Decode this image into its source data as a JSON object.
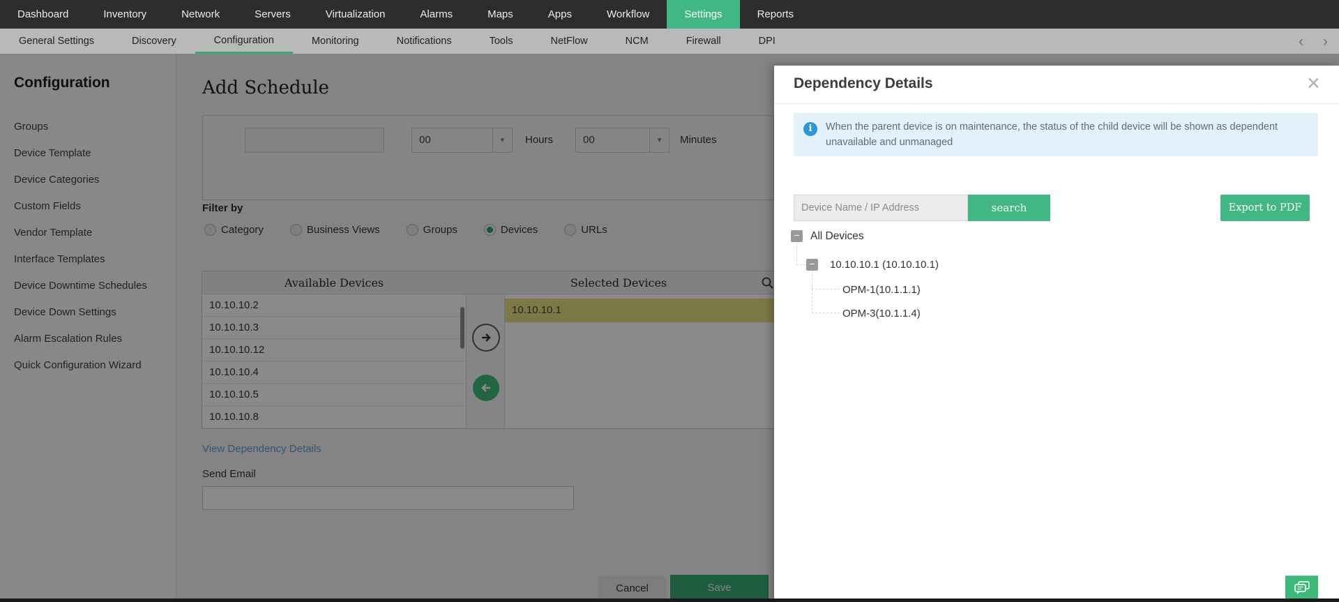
{
  "topnav": {
    "items": [
      "Dashboard",
      "Inventory",
      "Network",
      "Servers",
      "Virtualization",
      "Alarms",
      "Maps",
      "Apps",
      "Workflow",
      "Settings",
      "Reports"
    ],
    "active": "Settings"
  },
  "subnav": {
    "items": [
      "General Settings",
      "Discovery",
      "Configuration",
      "Monitoring",
      "Notifications",
      "Tools",
      "NetFlow",
      "NCM",
      "Firewall",
      "DPI"
    ],
    "active": "Configuration"
  },
  "sidebar": {
    "title": "Configuration",
    "items": [
      "Groups",
      "Device Template",
      "Device Categories",
      "Custom Fields",
      "Vendor Template",
      "Interface Templates",
      "Device Downtime Schedules",
      "Device Down Settings",
      "Alarm Escalation Rules",
      "Quick Configuration Wizard"
    ]
  },
  "main": {
    "title": "Add Schedule",
    "schedule": {
      "time_value": "",
      "hours_value": "00",
      "hours_label": "Hours",
      "minutes_value": "00",
      "minutes_label": "Minutes"
    },
    "filter_label": "Filter by",
    "filter_options": [
      "Category",
      "Business Views",
      "Groups",
      "Devices",
      "URLs"
    ],
    "filter_selected": "Devices",
    "picker": {
      "available_header": "Available Devices",
      "selected_header": "Selected Devices",
      "available": [
        "10.10.10.2",
        "10.10.10.3",
        "10.10.10.12",
        "10.10.10.4",
        "10.10.10.5",
        "10.10.10.8"
      ],
      "selected": [
        "10.10.10.1"
      ]
    },
    "dependency_link": "View Dependency Details",
    "send_email_label": "Send Email",
    "email_value": "",
    "buttons": {
      "cancel": "Cancel",
      "save": "Save"
    }
  },
  "panel": {
    "title": "Dependency Details",
    "info": "When the parent device is on maintenance, the status of the child device will be shown as dependent unavailable and unmanaged",
    "search": {
      "placeholder": "Device Name / IP Address",
      "button": "search",
      "value": ""
    },
    "export_button": "Export to PDF",
    "tree": {
      "root": "All Devices",
      "children": [
        {
          "label": "10.10.10.1 (10.10.10.1)",
          "children": [
            "OPM-1(10.1.1.1)",
            "OPM-3(10.1.1.4)"
          ]
        }
      ]
    }
  },
  "icons": {
    "caret_down": "▾",
    "chevron_left": "‹",
    "chevron_right": "›",
    "close": "✕",
    "minus": "−",
    "info": "i"
  },
  "colors": {
    "accent_green": "#41b883",
    "nav_dark": "#2d2d2d",
    "subnav_gray": "#b9b9b9",
    "selected_row_yellow": "#e2dc82",
    "info_blue_bg": "#e3f1fb",
    "info_icon_blue": "#2d96d8",
    "link_blue": "#5b9bd5"
  }
}
